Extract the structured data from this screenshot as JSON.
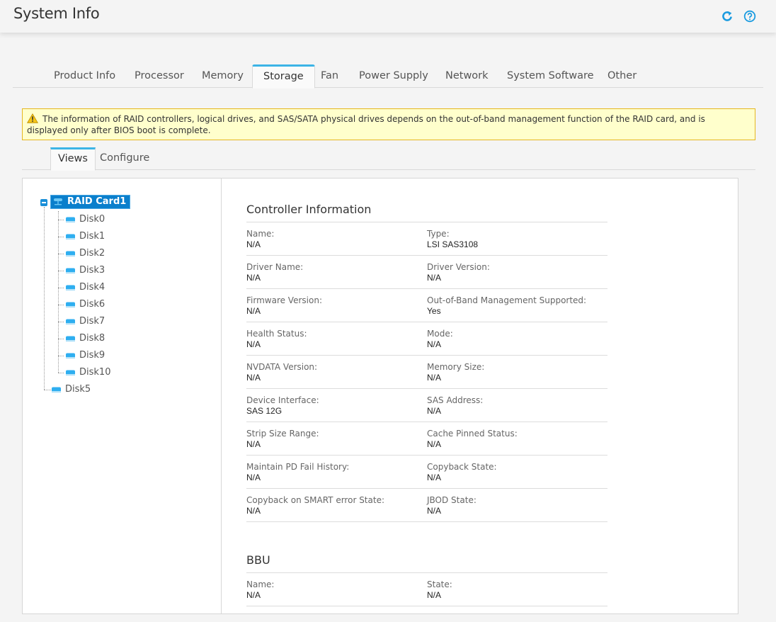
{
  "header": {
    "title": "System Info",
    "icons": [
      "refresh-icon",
      "help-icon"
    ],
    "accent_color": "#1a9be0"
  },
  "main_tabs": [
    {
      "label": "Product Info",
      "active": false
    },
    {
      "label": "Processor",
      "active": false
    },
    {
      "label": "Memory",
      "active": false
    },
    {
      "label": "Storage",
      "active": true
    },
    {
      "label": "Fan",
      "active": false
    },
    {
      "label": "Power Supply",
      "active": false
    },
    {
      "label": "Network",
      "active": false
    },
    {
      "label": "System Software",
      "active": false
    },
    {
      "label": "Other",
      "active": false
    }
  ],
  "warning": {
    "icon": "warning-icon",
    "text": "The information of RAID controllers, logical drives, and SAS/SATA physical drives depends on the out-of-band management function of the RAID card, and is displayed only after BIOS boot is complete."
  },
  "sub_tabs": [
    {
      "label": "Views",
      "active": true
    },
    {
      "label": "Configure",
      "active": false
    }
  ],
  "tree": {
    "root": {
      "label": "RAID Card1",
      "icon": "raid-card-icon",
      "selected": true,
      "expanded": true
    },
    "children": [
      "Disk0",
      "Disk1",
      "Disk2",
      "Disk3",
      "Disk4",
      "Disk6",
      "Disk7",
      "Disk8",
      "Disk9",
      "Disk10"
    ],
    "siblings": [
      "Disk5"
    ]
  },
  "controller": {
    "title": "Controller Information",
    "rows": [
      [
        {
          "label": "Name:",
          "value": "N/A"
        },
        {
          "label": "Type:",
          "value": "LSI SAS3108"
        }
      ],
      [
        {
          "label": "Driver Name:",
          "value": "N/A"
        },
        {
          "label": "Driver Version:",
          "value": "N/A"
        }
      ],
      [
        {
          "label": "Firmware Version:",
          "value": "N/A"
        },
        {
          "label": "Out-of-Band Management Supported:",
          "value": "Yes"
        }
      ],
      [
        {
          "label": "Health Status:",
          "value": "N/A"
        },
        {
          "label": "Mode:",
          "value": "N/A"
        }
      ],
      [
        {
          "label": "NVDATA Version:",
          "value": "N/A"
        },
        {
          "label": "Memory Size:",
          "value": "N/A"
        }
      ],
      [
        {
          "label": "Device Interface:",
          "value": "SAS 12G"
        },
        {
          "label": "SAS Address:",
          "value": "N/A"
        }
      ],
      [
        {
          "label": "Strip Size Range:",
          "value": "N/A"
        },
        {
          "label": "Cache Pinned Status:",
          "value": "N/A"
        }
      ],
      [
        {
          "label": "Maintain PD Fail History:",
          "value": "N/A"
        },
        {
          "label": "Copyback State:",
          "value": "N/A"
        }
      ],
      [
        {
          "label": "Copyback on SMART error State:",
          "value": "N/A"
        },
        {
          "label": "JBOD State:",
          "value": "N/A"
        }
      ]
    ]
  },
  "bbu": {
    "title": "BBU",
    "rows": [
      [
        {
          "label": "Name:",
          "value": "N/A"
        },
        {
          "label": "State:",
          "value": "N/A"
        }
      ]
    ]
  }
}
